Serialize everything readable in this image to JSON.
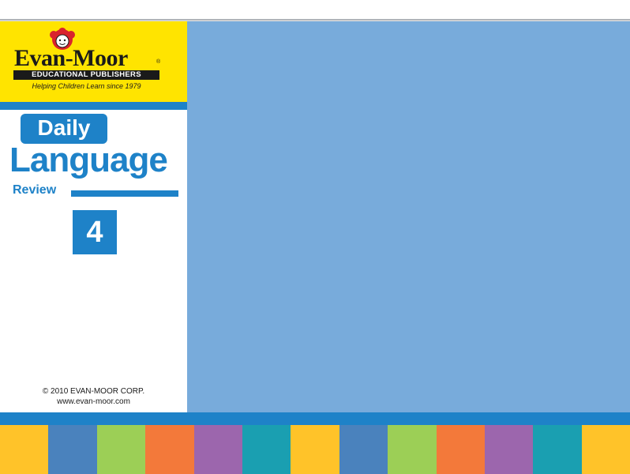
{
  "logo": {
    "wordmark": "Evan-Moor",
    "registered": "®",
    "publisher": "EDUCATIONAL PUBLISHERS",
    "tagline": "Helping Children Learn since 1979",
    "mascot_icon": "red-haired-child-mascot"
  },
  "title": {
    "line1": "Daily",
    "line2": "Language",
    "line3": "Review",
    "grade": "4"
  },
  "footer_text": {
    "copyright": "© 2010 EVAN-MOOR CORP.",
    "website": "www.evan-moor.com"
  },
  "colors": {
    "logo_bg": "#ffe400",
    "brand_blue": "#1e82c8",
    "content_bg": "#78abdb",
    "swatches": [
      "#ffc329",
      "#4a82bd",
      "#9ccf56",
      "#f3793a",
      "#9c66ad",
      "#1a9fb1",
      "#ffc329",
      "#4a82bd",
      "#9ccf56",
      "#f3793a",
      "#9c66ad",
      "#1a9fb1",
      "#ffc329"
    ]
  }
}
